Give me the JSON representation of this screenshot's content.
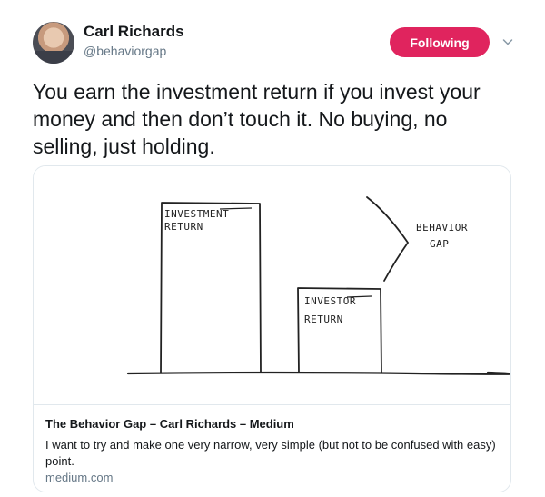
{
  "author": {
    "name": "Carl Richards",
    "handle": "@behaviorgap"
  },
  "follow_button": {
    "label": "Following",
    "color": "#e0245e"
  },
  "menu": {
    "icon": "chevron-down-icon"
  },
  "tweet": {
    "text": "You earn the investment return if you invest your money and then don’t touch it. No buying, no selling, just holding."
  },
  "card": {
    "image_labels": {
      "investment": "INVESTMENT",
      "return_1": "RETURN",
      "investor": "INVESTOR",
      "return_2": "RETURN",
      "behavior": "BEHAVIOR",
      "gap": "GAP"
    },
    "title": "The Behavior Gap – Carl Richards – Medium",
    "description": "I want to try and make one very narrow, very simple (but not to be confused with easy) point.",
    "domain": "medium.com"
  }
}
